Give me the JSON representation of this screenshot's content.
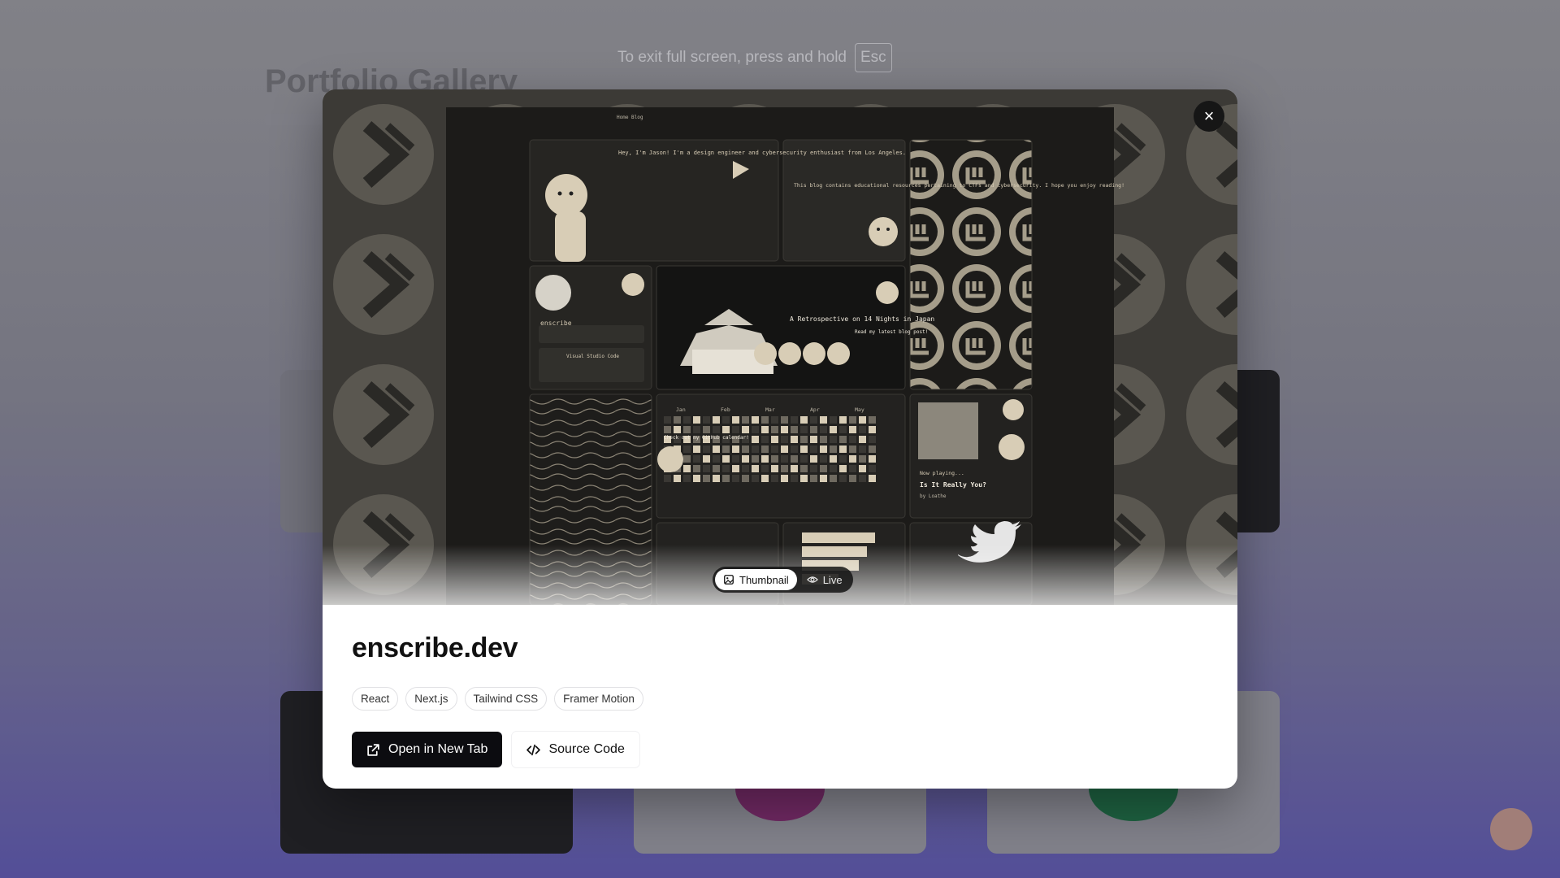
{
  "fullscreen_notice": {
    "text": "To exit full screen, press and hold",
    "key": "Esc"
  },
  "background": {
    "page_title": "Portfolio Gallery"
  },
  "modal": {
    "close_label": "×",
    "preview_toggle": {
      "thumbnail_label": "Thumbnail",
      "live_label": "Live",
      "selected": "Thumbnail"
    },
    "title": "enscribe.dev",
    "tags": [
      "React",
      "Next.js",
      "Tailwind CSS",
      "Framer Motion"
    ],
    "actions": {
      "open_new_tab_label": "Open in New Tab",
      "source_code_label": "Source Code"
    },
    "screenshot_text": {
      "nav_home": "Home",
      "nav_blog": "Blog",
      "intro": "Hey, I'm Jason! I'm a design engineer and cybersecurity enthusiast from Los Angeles.",
      "blog_note": "This blog contains educational resources pertaining to CTFs and cybersecurity. I hope you enjoy reading!",
      "profile_name": "enscribe",
      "vscode_title": "Visual Studio Code",
      "post_title": "A Retrospective on 14 Nights in Japan",
      "read_latest": "Read my latest blog post!",
      "months": [
        "Jan",
        "Feb",
        "Mar",
        "Apr",
        "May"
      ],
      "calendar_note": "Check out my GitHub calendar!",
      "now_playing": "Now playing...",
      "song_title": "Is It Really You?",
      "song_artist": "by Loathe"
    }
  },
  "colors": {
    "primary_button": "#0c0c10",
    "overlay_background": "#7f7f8c",
    "screenshot_bg": "#1c1b19",
    "screenshot_accent": "#d8cdb6"
  }
}
